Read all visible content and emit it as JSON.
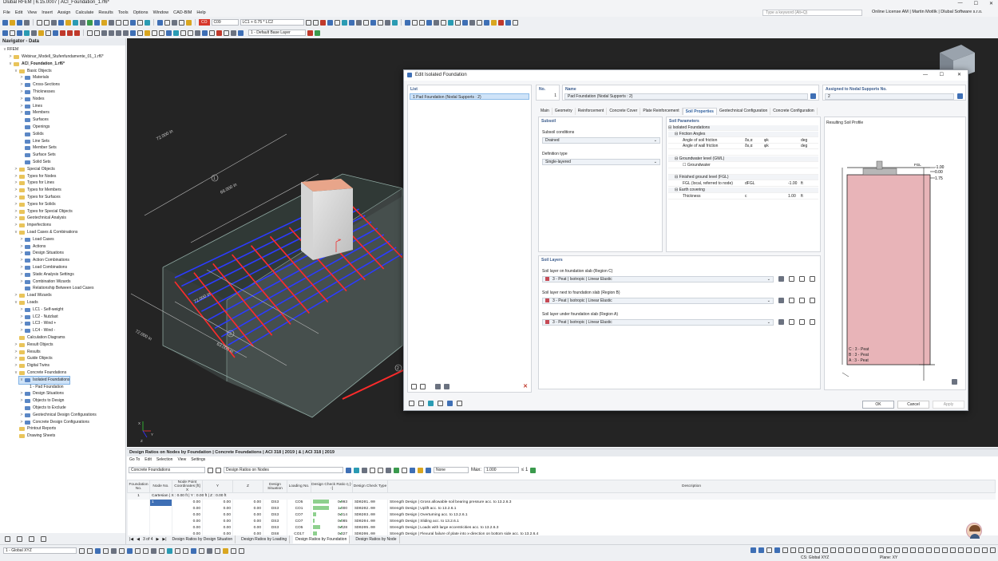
{
  "window": {
    "title": "Dlubal RFEM | 6.15.0007 | ACI_Foundation_1.rf6*"
  },
  "menu": {
    "items": [
      "File",
      "Edit",
      "View",
      "Insert",
      "Assign",
      "Calculate",
      "Results",
      "Tools",
      "Options",
      "Window",
      "CAD-BIM",
      "Help"
    ],
    "search_placeholder": "Type a keyword (Alt+Q)",
    "license": "Online License AM | Martin Motlík | Dlubal Software s.r.o."
  },
  "toolbar": {
    "co_badge": "CO",
    "co_number": "C09",
    "load_case": "LC1 + 0.75 * LC2",
    "co_combo": "CO9",
    "base_layer": "1 - Default Base Layer"
  },
  "navigator": {
    "title": "Navigator - Data",
    "root": "RFEM",
    "items": [
      {
        "label": "Webinar_Modell_Stufenfundamente_01_1.rf6*",
        "level": 1,
        "tog": ">",
        "icon": "file"
      },
      {
        "label": "ACI_Foundation_1.rf6*",
        "level": 1,
        "tog": "v",
        "icon": "file",
        "bold": true
      },
      {
        "label": "Basic Objects",
        "level": 2,
        "tog": "v",
        "icon": "folder"
      },
      {
        "label": "Materials",
        "level": 3,
        "tog": ">",
        "icon": "obj"
      },
      {
        "label": "Cross-Sections",
        "level": 3,
        "tog": ">",
        "icon": "obj"
      },
      {
        "label": "Thicknesses",
        "level": 3,
        "tog": ">",
        "icon": "obj"
      },
      {
        "label": "Nodes",
        "level": 3,
        "tog": ">",
        "icon": "obj"
      },
      {
        "label": "Lines",
        "level": 3,
        "tog": ">",
        "icon": "obj"
      },
      {
        "label": "Members",
        "level": 3,
        "tog": ">",
        "icon": "obj"
      },
      {
        "label": "Surfaces",
        "level": 3,
        "tog": "",
        "icon": "obj"
      },
      {
        "label": "Openings",
        "level": 3,
        "tog": "",
        "icon": "obj"
      },
      {
        "label": "Solids",
        "level": 3,
        "tog": "",
        "icon": "obj"
      },
      {
        "label": "Line Sets",
        "level": 3,
        "tog": "",
        "icon": "obj"
      },
      {
        "label": "Member Sets",
        "level": 3,
        "tog": "",
        "icon": "obj"
      },
      {
        "label": "Surface Sets",
        "level": 3,
        "tog": "",
        "icon": "obj"
      },
      {
        "label": "Solid Sets",
        "level": 3,
        "tog": "",
        "icon": "obj"
      },
      {
        "label": "Special Objects",
        "level": 2,
        "tog": ">",
        "icon": "folder"
      },
      {
        "label": "Types for Nodes",
        "level": 2,
        "tog": ">",
        "icon": "folder"
      },
      {
        "label": "Types for Lines",
        "level": 2,
        "tog": ">",
        "icon": "folder"
      },
      {
        "label": "Types for Members",
        "level": 2,
        "tog": ">",
        "icon": "folder"
      },
      {
        "label": "Types for Surfaces",
        "level": 2,
        "tog": ">",
        "icon": "folder"
      },
      {
        "label": "Types for Solids",
        "level": 2,
        "tog": ">",
        "icon": "folder"
      },
      {
        "label": "Types for Special Objects",
        "level": 2,
        "tog": ">",
        "icon": "folder"
      },
      {
        "label": "Geotechnical Analysis",
        "level": 2,
        "tog": ">",
        "icon": "folder"
      },
      {
        "label": "Imperfections",
        "level": 2,
        "tog": ">",
        "icon": "folder"
      },
      {
        "label": "Load Cases & Combinations",
        "level": 2,
        "tog": "v",
        "icon": "folder"
      },
      {
        "label": "Load Cases",
        "level": 3,
        "tog": ">",
        "icon": "obj"
      },
      {
        "label": "Actions",
        "level": 3,
        "tog": ">",
        "icon": "obj"
      },
      {
        "label": "Design Situations",
        "level": 3,
        "tog": ">",
        "icon": "obj"
      },
      {
        "label": "Action Combinations",
        "level": 3,
        "tog": ">",
        "icon": "obj"
      },
      {
        "label": "Load Combinations",
        "level": 3,
        "tog": ">",
        "icon": "obj"
      },
      {
        "label": "Static Analysis Settings",
        "level": 3,
        "tog": ">",
        "icon": "obj"
      },
      {
        "label": "Combination Wizards",
        "level": 3,
        "tog": ">",
        "icon": "obj"
      },
      {
        "label": "Relationship Between Load Cases",
        "level": 3,
        "tog": "",
        "icon": "obj"
      },
      {
        "label": "Load Wizards",
        "level": 2,
        "tog": ">",
        "icon": "folder"
      },
      {
        "label": "Loads",
        "level": 2,
        "tog": "v",
        "icon": "folder"
      },
      {
        "label": "LC1 - Self-weight",
        "level": 3,
        "tog": ">",
        "icon": "obj"
      },
      {
        "label": "LC2 - Nutzlast",
        "level": 3,
        "tog": ">",
        "icon": "obj"
      },
      {
        "label": "LC3 - Wind +",
        "level": 3,
        "tog": ">",
        "icon": "obj"
      },
      {
        "label": "LC4 - Wind -",
        "level": 3,
        "tog": ">",
        "icon": "obj"
      },
      {
        "label": "Calculation Diagrams",
        "level": 2,
        "tog": "",
        "icon": "folder"
      },
      {
        "label": "Result Objects",
        "level": 2,
        "tog": ">",
        "icon": "folder"
      },
      {
        "label": "Results",
        "level": 2,
        "tog": ">",
        "icon": "folder"
      },
      {
        "label": "Guide Objects",
        "level": 2,
        "tog": ">",
        "icon": "folder"
      },
      {
        "label": "Digital Twins",
        "level": 2,
        "tog": ">",
        "icon": "folder"
      },
      {
        "label": "Concrete Foundations",
        "level": 2,
        "tog": "v",
        "icon": "folder"
      },
      {
        "label": "Isolated Foundations",
        "level": 3,
        "tog": "v",
        "icon": "obj",
        "selected": true
      },
      {
        "label": "1 - Pad Foundation",
        "level": 4,
        "tog": "",
        "icon": "none"
      },
      {
        "label": "Design Situations",
        "level": 3,
        "tog": ">",
        "icon": "obj"
      },
      {
        "label": "Objects to Design",
        "level": 3,
        "tog": ">",
        "icon": "obj"
      },
      {
        "label": "Objects to Exclude",
        "level": 3,
        "tog": "",
        "icon": "obj"
      },
      {
        "label": "Geotechnical Design Configurations",
        "level": 3,
        "tog": ">",
        "icon": "obj"
      },
      {
        "label": "Concrete Design Configurations",
        "level": 3,
        "tog": ">",
        "icon": "obj"
      },
      {
        "label": "Printout Reports",
        "level": 2,
        "tog": "",
        "icon": "folder"
      },
      {
        "label": "Drawing Sheets",
        "level": 2,
        "tog": "",
        "icon": "folder"
      }
    ],
    "coord_system": "1 - Global XYZ"
  },
  "viewport": {
    "dims": [
      "72.000 in",
      "66.000 in",
      "72.000 in",
      "63.000 in",
      "72.000 in"
    ],
    "callouts": [
      "1",
      "3",
      "2",
      "1"
    ],
    "axis_labels": [
      "X",
      "Y",
      "Z"
    ]
  },
  "dialog": {
    "title": "Edit Isolated Foundation",
    "list_header": "List",
    "list_item": "1  Pad Foundation (Nodal Supports : 2)",
    "no_header": "No.",
    "no_value": "1",
    "name_header": "Name",
    "name_value": "Pad Foundation (Nodal Supports : 2)",
    "assigned_header": "Assigned to Nodal Supports No.",
    "assigned_value": "2",
    "tabs": [
      "Main",
      "Geometry",
      "Reinforcement",
      "Concrete Cover",
      "Plate Reinforcement",
      "Soil Properties",
      "Geotechnical Configuration",
      "Concrete Configuration"
    ],
    "active_tab": "Soil Properties",
    "subsoil": {
      "title": "Subsoil",
      "conditions_label": "Subsoil conditions",
      "conditions_value": "Drained",
      "definition_label": "Definition type",
      "definition_value": "Single-layered"
    },
    "soil_params": {
      "title": "Soil Parameters",
      "rows": [
        {
          "label": "Isolated Foundations",
          "sym": "",
          "val": "",
          "unit": "",
          "indent": 0,
          "group": true
        },
        {
          "label": "Friction Angles",
          "sym": "",
          "val": "",
          "unit": "",
          "indent": 1,
          "group": true
        },
        {
          "label": "Angle of soil friction",
          "sym": "δs,α",
          "sym2": "φk",
          "val": "",
          "unit": "deg",
          "indent": 2
        },
        {
          "label": "Angle of wall friction",
          "sym": "δs,α",
          "sym2": "φk",
          "val": "",
          "unit": "deg",
          "indent": 2
        },
        {
          "label": "",
          "sym": "",
          "val": "",
          "unit": "",
          "indent": 0
        },
        {
          "label": "Groundwater level (GWL)",
          "sym": "",
          "val": "",
          "unit": "",
          "indent": 1,
          "group": true
        },
        {
          "label": "Groundwater",
          "sym": "",
          "val": "",
          "unit": "",
          "indent": 2,
          "check": true
        },
        {
          "label": "",
          "sym": "",
          "val": "",
          "unit": "",
          "indent": 0
        },
        {
          "label": "Finished ground level (FGL)",
          "sym": "",
          "val": "",
          "unit": "",
          "indent": 1,
          "group": true
        },
        {
          "label": "FGL (local, referred to node)",
          "sym": "dFGL",
          "val": "-1.00",
          "unit": "ft",
          "indent": 2
        },
        {
          "label": "Earth covering",
          "sym": "",
          "val": "",
          "unit": "",
          "indent": 1,
          "group": true
        },
        {
          "label": "Thickness",
          "sym": "c",
          "val": "1.00",
          "unit": "ft",
          "indent": 2
        }
      ]
    },
    "profile": {
      "title": "Resulting Soil Profile",
      "levels": [
        "-1.00",
        "0.00",
        "1.75"
      ],
      "fgl": "FGL",
      "legend": [
        "C : 3 - Peat",
        "B : 3 - Peat",
        "A : 3 - Peat"
      ]
    },
    "soil_layers": {
      "title": "Soil Layers",
      "items": [
        {
          "label": "Soil layer on foundation slab (Region C)",
          "value": "3 - Peat | Isotropic | Linear Elastic"
        },
        {
          "label": "Soil layer next to foundation slab (Region B)",
          "value": "3 - Peat | Isotropic | Linear Elastic"
        },
        {
          "label": "Soil layer under foundation slab (Region A)",
          "value": "3 - Peat | Isotropic | Linear Elastic"
        }
      ]
    },
    "buttons": {
      "ok": "OK",
      "cancel": "Cancel",
      "apply": "Apply"
    }
  },
  "results": {
    "title": "Design Ratios on Nodes by Foundation | Concrete Foundations | ACI 318 | 2019 | & | ACI 318 | 2019",
    "menu": [
      "Go To",
      "Edit",
      "Selection",
      "View",
      "Settings"
    ],
    "module_combo": "Concrete Foundations",
    "view_combo": "Design Ratios on Nodes",
    "none_combo": "None",
    "max_label": "Max:",
    "max_value": "1.000",
    "le_label": "≤ 1",
    "columns": [
      "Foundation No.",
      "Node No.",
      "X",
      "Y",
      "Z",
      "Design Situation",
      "Loading No.",
      "Design Check Ratio η [--]",
      "Design Check Type",
      "Description"
    ],
    "coord_header": "Node Point Coordinates [ft]",
    "group_row": "Cartesian | X : 0.00 ft | Y : 0.00 ft | Z : 0.00 ft",
    "foundation_no": "1",
    "node_no": "1",
    "rows": [
      {
        "x": "0.00",
        "y": "0.00",
        "z": "0.00",
        "ds": "DS3",
        "lo": "CO5",
        "ratio": "0.993",
        "ok": "✔",
        "type": "SD0201.00",
        "desc": "Strength Design | Gross allowable soil bearing pressure acc. to 13.2.6.3"
      },
      {
        "x": "0.00",
        "y": "0.00",
        "z": "0.00",
        "ds": "DS3",
        "lo": "CO1",
        "ratio": "1.000",
        "ok": "✔",
        "type": "SD0202.00",
        "desc": "Strength Design | Uplift acc. to 13.2.6.1"
      },
      {
        "x": "0.00",
        "y": "0.00",
        "z": "0.00",
        "ds": "DS3",
        "lo": "CO7",
        "ratio": "0.214",
        "ok": "✔",
        "type": "SD0203.00",
        "desc": "Strength Design | Overturning acc. to 13.2.6.1"
      },
      {
        "x": "0.00",
        "y": "0.00",
        "z": "0.00",
        "ds": "DS3",
        "lo": "CO7",
        "ratio": "0.085",
        "ok": "✔",
        "type": "SD0204.00",
        "desc": "Strength Design | Sliding acc. to 13.2.6.1"
      },
      {
        "x": "0.00",
        "y": "0.00",
        "z": "0.00",
        "ds": "DS3",
        "lo": "CO5",
        "ratio": "0.428",
        "ok": "✔",
        "type": "SD0205.00",
        "desc": "Strength Design | Loads with large eccentricities acc. to 13.2.6.3"
      },
      {
        "x": "0.00",
        "y": "0.00",
        "z": "0.00",
        "ds": "DS8",
        "lo": "CO17",
        "ratio": "0.227",
        "ok": "✔",
        "type": "SD0206.00",
        "desc": "Strength Design | Flexural failure of plate into x-direction on bottom side acc. to 13.2.6.4"
      }
    ],
    "pager": "3 of 4",
    "tabs": [
      "Design Ratios by Design Situation",
      "Design Ratios by Loading",
      "Design Ratios by Foundation",
      "Design Ratios by Node"
    ],
    "active_tab": "Design Ratios by Foundation"
  },
  "status": {
    "cs": "CS: Global XYZ",
    "plane": "Plane: XY"
  },
  "colors": {
    "accent": "#2f6db5",
    "rebar_red": "#ff2b2b",
    "rebar_blue": "#2b3bff",
    "soil": "#e8b4b8"
  }
}
